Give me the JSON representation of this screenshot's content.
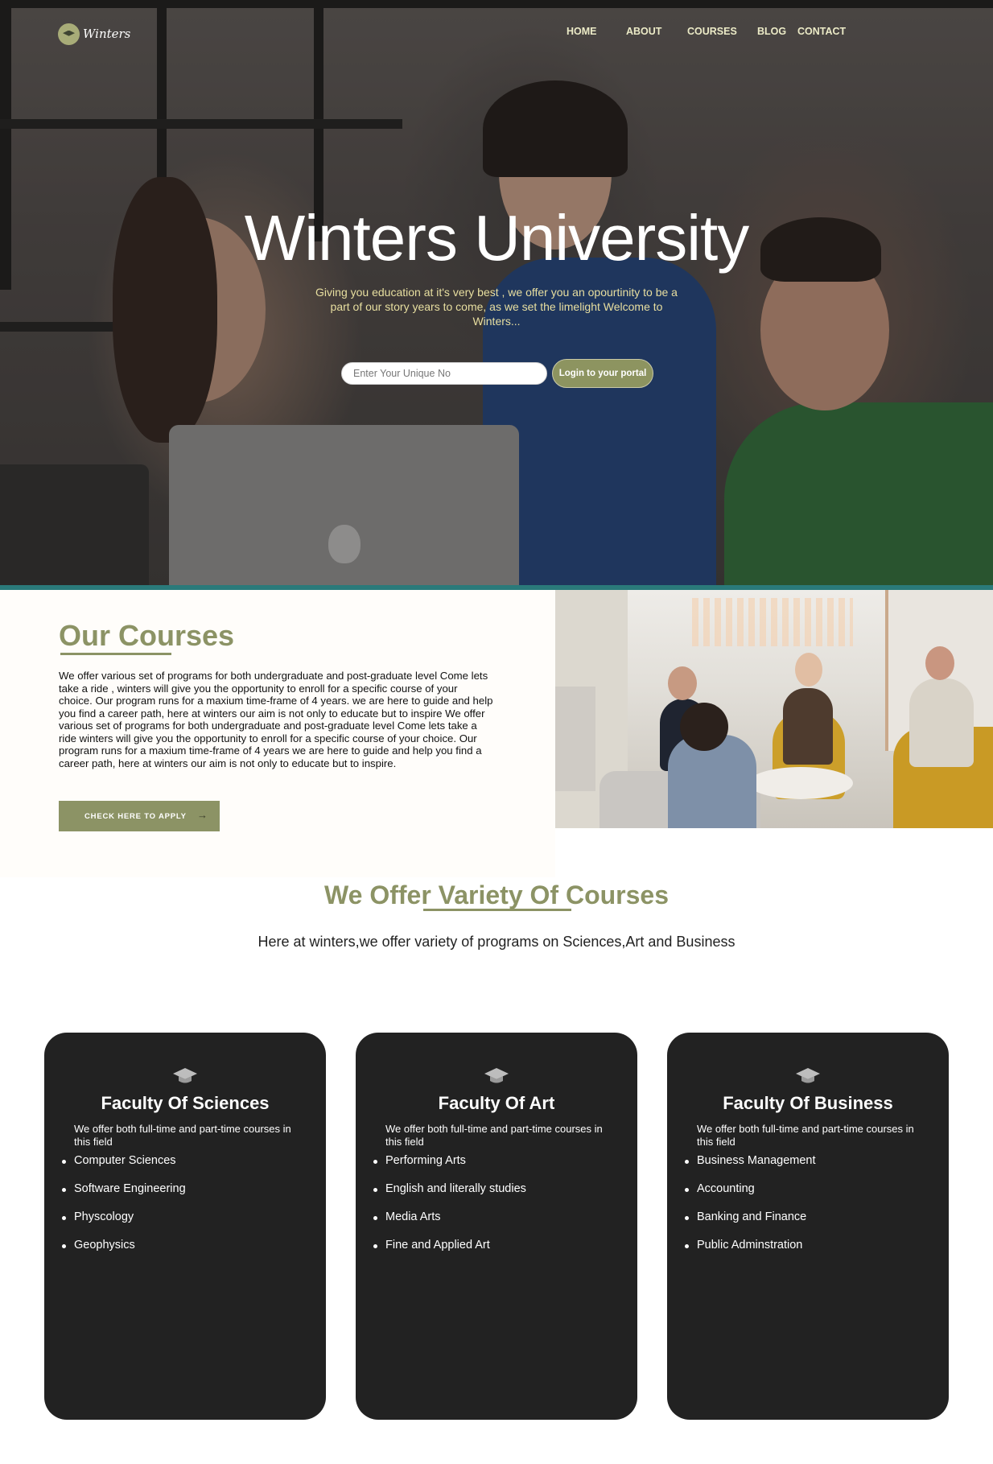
{
  "brand": {
    "name": "Winters"
  },
  "nav": [
    {
      "label": "HOME"
    },
    {
      "label": "ABOUT"
    },
    {
      "label": "COURSES"
    },
    {
      "label": "BLOG"
    },
    {
      "label": "CONTACT"
    }
  ],
  "hero": {
    "title": "Winters University",
    "subtitle": "Giving you education at it's very best , we offer you an opourtinity to be a part of our story years to come, as we set the limelight Welcome to Winters...",
    "input_placeholder": "Enter Your Unique No",
    "login_label": "Login to your portal"
  },
  "courses": {
    "title": "Our Courses",
    "text": "We offer various set of programs for both undergraduate and post-graduate level Come lets take a ride , winters will give you the opportunity to enroll for a specific course of your choice. Our program runs for a maxium time-frame of 4 years. we are here to guide and help you find a career path, here at winters our aim is not only to educate but to inspire We offer various set of programs for both undergraduate and post-graduate level Come lets take a ride winters will give you the opportunity to enroll for a specific course of your choice. Our program runs for a maxium time-frame of 4 years we are here to guide and help you find a career path, here at winters our aim is not only to educate but to inspire.",
    "apply_label": "CHECK HERE TO APPLY"
  },
  "variety": {
    "title": "We Offer Variety Of Courses",
    "subtitle": "Here at winters,we offer variety of programs on Sciences,Art and Business"
  },
  "faculties": [
    {
      "title": "Faculty Of Sciences",
      "description": "We offer both full-time and part-time courses in this field",
      "items": [
        "Computer Sciences",
        "Software Engineering",
        "Physcology",
        "Geophysics"
      ]
    },
    {
      "title": "Faculty Of Art",
      "description": "We offer both full-time and part-time courses in this field",
      "items": [
        "Performing Arts",
        "English and literally studies",
        "Media Arts",
        "Fine and Applied Art"
      ]
    },
    {
      "title": "Faculty Of Business",
      "description": "We offer both full-time and part-time courses in this field",
      "items": [
        "Business Management",
        "Accounting",
        "Banking and Finance",
        "Public Adminstration"
      ]
    }
  ],
  "colors": {
    "accent": "#8c9365",
    "teal_divider": "#2a7a7a",
    "card_bg": "#222222",
    "nav_text": "#ecebc7"
  },
  "icons": [
    "logo-icon",
    "graduation-cap-icon",
    "arrow-right-icon"
  ]
}
